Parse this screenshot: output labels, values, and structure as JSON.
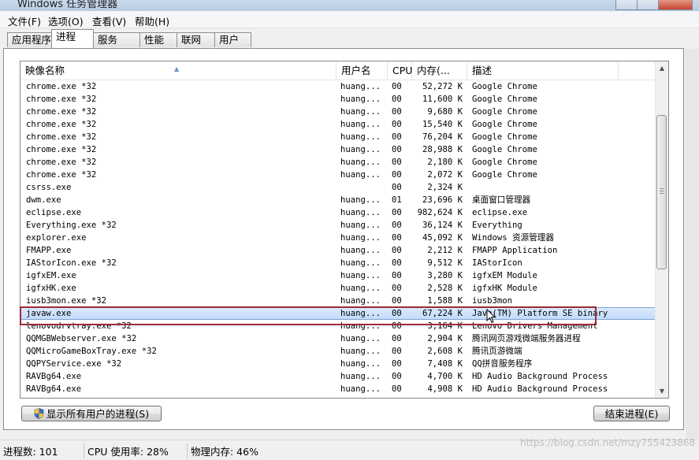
{
  "window": {
    "title": "Windows 任务管理器"
  },
  "menu": [
    "文件(F)",
    "选项(O)",
    "查看(V)",
    "帮助(H)"
  ],
  "tabs": [
    {
      "label": "应用程序",
      "active": false
    },
    {
      "label": "进程",
      "active": true
    },
    {
      "label": "服务",
      "active": false
    },
    {
      "label": "性能",
      "active": false
    },
    {
      "label": "联网",
      "active": false
    },
    {
      "label": "用户",
      "active": false
    }
  ],
  "columns": {
    "name": "映像名称",
    "user": "用户名",
    "cpu": "CPU",
    "mem": "内存(...",
    "desc": "描述"
  },
  "rows": [
    {
      "name": "chrome.exe *32",
      "user": "huang...",
      "cpu": "00",
      "mem": "52,272 K",
      "desc": "Google Chrome"
    },
    {
      "name": "chrome.exe *32",
      "user": "huang...",
      "cpu": "00",
      "mem": "11,600 K",
      "desc": "Google Chrome"
    },
    {
      "name": "chrome.exe *32",
      "user": "huang...",
      "cpu": "00",
      "mem": "9,680 K",
      "desc": "Google Chrome"
    },
    {
      "name": "chrome.exe *32",
      "user": "huang...",
      "cpu": "00",
      "mem": "15,540 K",
      "desc": "Google Chrome"
    },
    {
      "name": "chrome.exe *32",
      "user": "huang...",
      "cpu": "00",
      "mem": "76,204 K",
      "desc": "Google Chrome"
    },
    {
      "name": "chrome.exe *32",
      "user": "huang...",
      "cpu": "00",
      "mem": "28,988 K",
      "desc": "Google Chrome"
    },
    {
      "name": "chrome.exe *32",
      "user": "huang...",
      "cpu": "00",
      "mem": "2,180 K",
      "desc": "Google Chrome"
    },
    {
      "name": "chrome.exe *32",
      "user": "huang...",
      "cpu": "00",
      "mem": "2,072 K",
      "desc": "Google Chrome"
    },
    {
      "name": "csrss.exe",
      "user": "",
      "cpu": "00",
      "mem": "2,324 K",
      "desc": ""
    },
    {
      "name": "dwm.exe",
      "user": "huang...",
      "cpu": "01",
      "mem": "23,696 K",
      "desc": "桌面窗口管理器"
    },
    {
      "name": "eclipse.exe",
      "user": "huang...",
      "cpu": "00",
      "mem": "982,624 K",
      "desc": "eclipse.exe"
    },
    {
      "name": "Everything.exe *32",
      "user": "huang...",
      "cpu": "00",
      "mem": "36,124 K",
      "desc": "Everything"
    },
    {
      "name": "explorer.exe",
      "user": "huang...",
      "cpu": "00",
      "mem": "45,092 K",
      "desc": "Windows 资源管理器"
    },
    {
      "name": "FMAPP.exe",
      "user": "huang...",
      "cpu": "00",
      "mem": "2,212 K",
      "desc": "FMAPP Application"
    },
    {
      "name": "IAStorIcon.exe *32",
      "user": "huang...",
      "cpu": "00",
      "mem": "9,512 K",
      "desc": "IAStorIcon"
    },
    {
      "name": "igfxEM.exe",
      "user": "huang...",
      "cpu": "00",
      "mem": "3,280 K",
      "desc": "igfxEM Module"
    },
    {
      "name": "igfxHK.exe",
      "user": "huang...",
      "cpu": "00",
      "mem": "2,528 K",
      "desc": "igfxHK Module"
    },
    {
      "name": "iusb3mon.exe *32",
      "user": "huang...",
      "cpu": "00",
      "mem": "1,588 K",
      "desc": "iusb3mon"
    },
    {
      "name": "javaw.exe",
      "user": "huang...",
      "cpu": "00",
      "mem": "67,224 K",
      "desc": "Java(TM) Platform SE binary",
      "selected": true
    },
    {
      "name": "lenovodrvtray.exe *32",
      "user": "huang...",
      "cpu": "00",
      "mem": "3,164 K",
      "desc": "Lenovo Drivers Management"
    },
    {
      "name": "QQMGBWebserver.exe *32",
      "user": "huang...",
      "cpu": "00",
      "mem": "2,904 K",
      "desc": "腾讯网页游戏微端服务器进程"
    },
    {
      "name": "QQMicroGameBoxTray.exe *32",
      "user": "huang...",
      "cpu": "00",
      "mem": "2,608 K",
      "desc": "腾讯页游微端"
    },
    {
      "name": "QQPYService.exe *32",
      "user": "huang...",
      "cpu": "00",
      "mem": "7,408 K",
      "desc": "QQ拼音服务程序"
    },
    {
      "name": "RAVBg64.exe",
      "user": "huang...",
      "cpu": "00",
      "mem": "4,700 K",
      "desc": "HD Audio Background Process"
    },
    {
      "name": "RAVBg64.exe",
      "user": "huang...",
      "cpu": "00",
      "mem": "4,908 K",
      "desc": "HD Audio Background Process"
    }
  ],
  "buttons": {
    "show_all": "显示所有用户的进程(S)",
    "end_process": "结束进程(E)"
  },
  "status": {
    "processes": "进程数: 101",
    "cpu": "CPU 使用率: 28%",
    "memory": "物理内存: 46%"
  },
  "watermark": "https://blog.csdn.net/mzy755423868",
  "colors": {
    "selection": "#c1dbfc",
    "highlight_box": "#9c2a35"
  }
}
